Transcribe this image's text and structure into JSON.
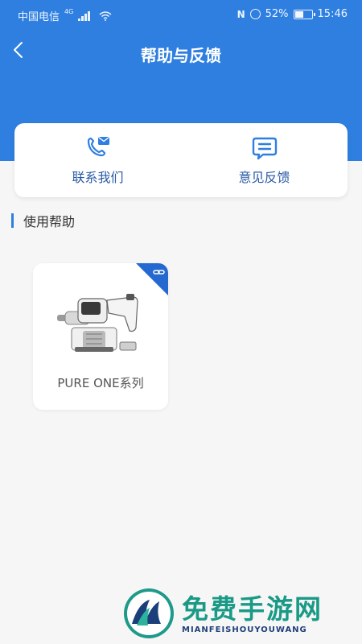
{
  "statusbar": {
    "carrier": "中国电信",
    "network_badge": "4G",
    "battery": "52%",
    "battery_level": 0.52,
    "time": "15:46"
  },
  "header": {
    "title": "帮助与反馈",
    "background_color": "#2f7fe0",
    "back_icon": "chevron-left-icon"
  },
  "contact": {
    "items": [
      {
        "label": "联系我们",
        "icon": "phone-mail-icon"
      },
      {
        "label": "意见反馈",
        "icon": "chat-bubble-icon"
      }
    ]
  },
  "help": {
    "section_title": "使用帮助",
    "products": [
      {
        "name": "PURE ONE系列",
        "icon": "link-icon"
      }
    ]
  },
  "watermark": {
    "cn": "免费手游网",
    "en": "MIANFEISHOUYOUWANG"
  }
}
